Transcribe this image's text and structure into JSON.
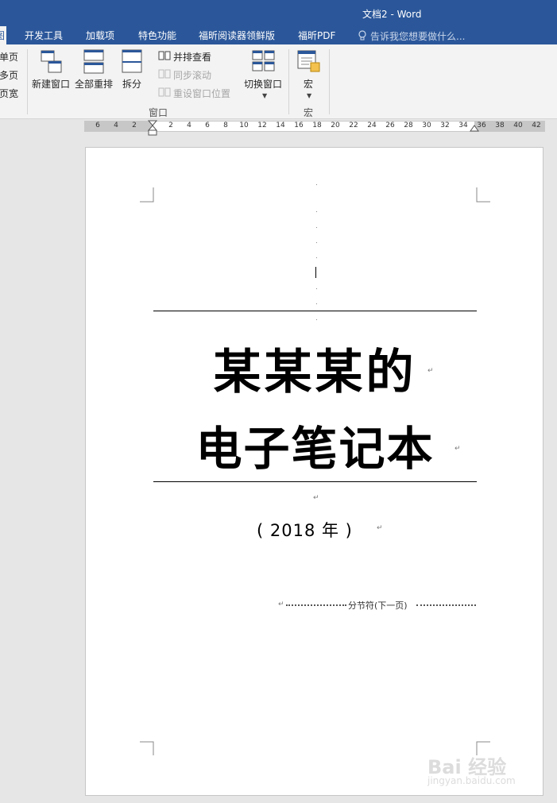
{
  "window": {
    "title": "文档2 - Word"
  },
  "tabs": [
    {
      "label": "图",
      "active": true
    },
    {
      "label": "开发工具"
    },
    {
      "label": "加载项"
    },
    {
      "label": "特色功能"
    },
    {
      "label": "福昕阅读器领鲜版"
    },
    {
      "label": "福昕PDF"
    }
  ],
  "tell_me": "告诉我您想要做什么...",
  "ribbon": {
    "zoom_partial": [
      "单页",
      "多页",
      "页宽"
    ],
    "window_group": {
      "new_window": "新建窗口",
      "arrange_all": "全部重排",
      "split": "拆分",
      "side_by_side": "并排查看",
      "sync_scroll": "同步滚动",
      "reset_window": "重设窗口位置",
      "switch_windows": "切换窗口",
      "label": "窗口"
    },
    "macros_group": {
      "macros": "宏",
      "label": "宏"
    }
  },
  "ruler": {
    "left_labels": [
      "6",
      "4",
      "2"
    ],
    "right_labels": [
      "2",
      "4",
      "6",
      "8",
      "10",
      "12",
      "14",
      "16",
      "18",
      "20",
      "22",
      "24",
      "26",
      "28",
      "30",
      "32",
      "34",
      "36",
      "38",
      "40",
      "42"
    ]
  },
  "document": {
    "title_line1": "某某某的",
    "title_line2": "电子笔记本",
    "year_line": "( 2018 年 )",
    "section_break": "分节符(下一页)",
    "paragraph_mark": "↵"
  },
  "watermark": {
    "brand": "Bai 经验",
    "url": "jingyan.baidu.com"
  }
}
